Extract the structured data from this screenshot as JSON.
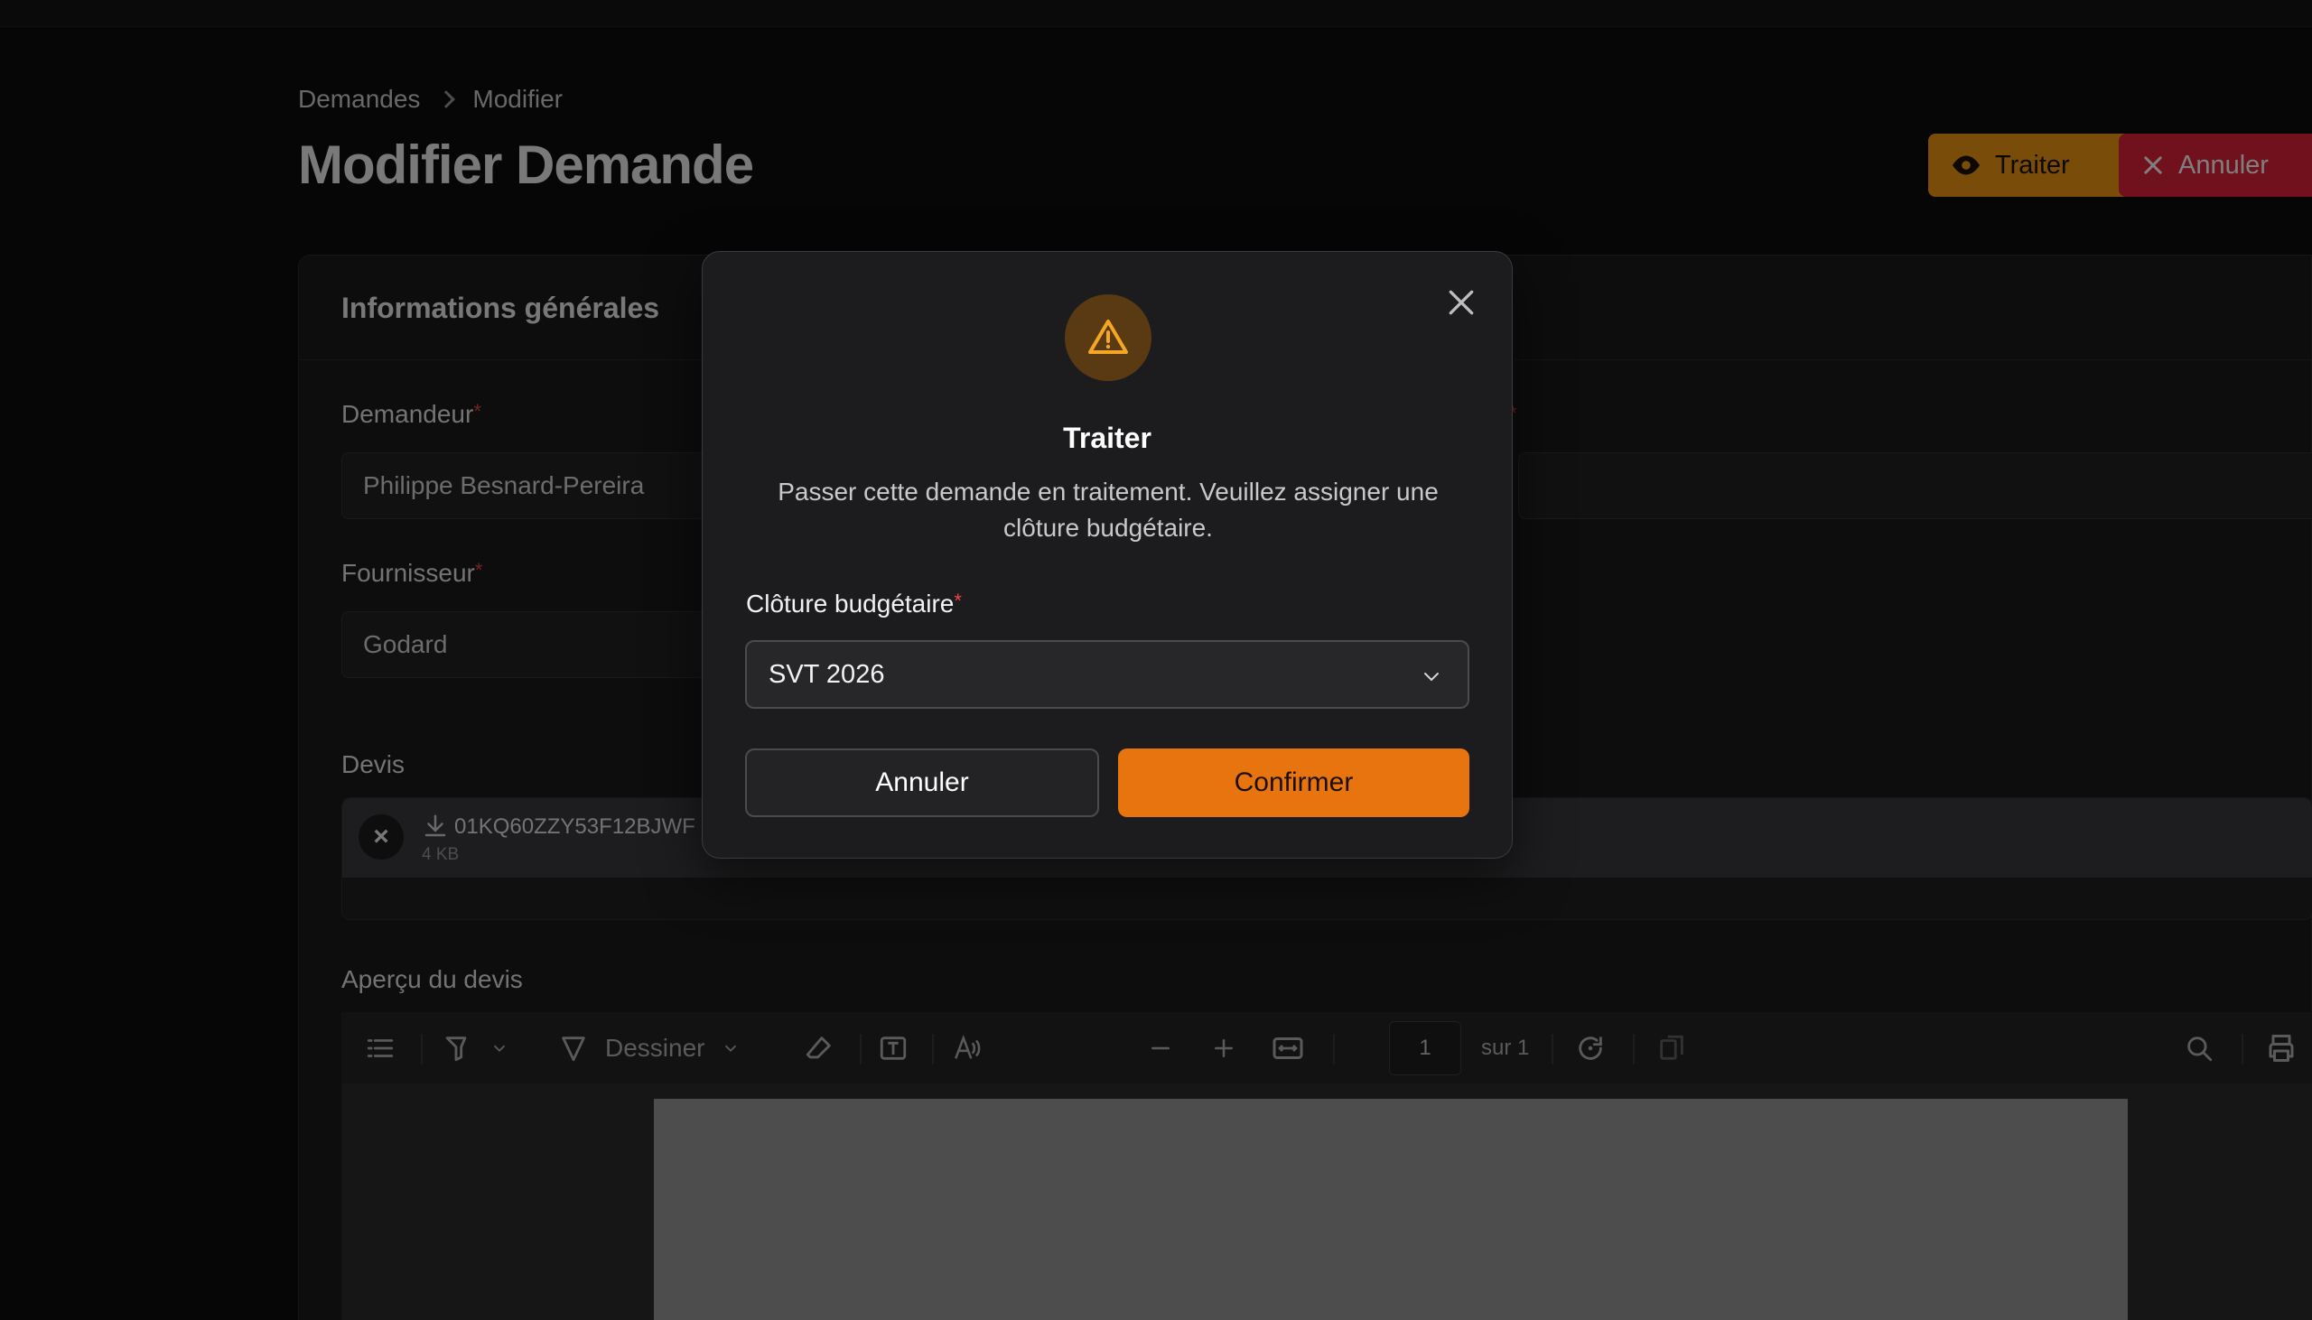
{
  "breadcrumb": {
    "items": [
      "Demandes",
      "Modifier"
    ]
  },
  "page": {
    "title": "Modifier Demande"
  },
  "header_actions": {
    "traiter_label": "Traiter",
    "annuler_label": "Annuler"
  },
  "card": {
    "title": "Informations générales",
    "fields": {
      "demandeur": {
        "label": "Demandeur",
        "required_mark": "*",
        "value": "Philippe Besnard-Pereira"
      },
      "fournisseur": {
        "label": "Fournisseur",
        "required_mark": "*",
        "value": "Godard"
      },
      "devis": {
        "label": "Devis",
        "file_name": "01KQ60ZZY53F12BJWF",
        "file_size": "4 KB"
      },
      "apercu": {
        "label": "Aperçu du devis"
      }
    },
    "right_required_mark": "*"
  },
  "pdf_toolbar": {
    "draw_label": "Dessiner",
    "page_value": "1",
    "page_total": "sur 1"
  },
  "modal": {
    "title": "Traiter",
    "description": "Passer cette demande en traitement. Veuillez assigner une clôture budgétaire.",
    "select_label": "Clôture budgétaire",
    "required_mark": "*",
    "select_value": "SVT 2026",
    "cancel_label": "Annuler",
    "confirm_label": "Confirmer",
    "icon": "warning-icon",
    "accent": "#e8740f"
  }
}
